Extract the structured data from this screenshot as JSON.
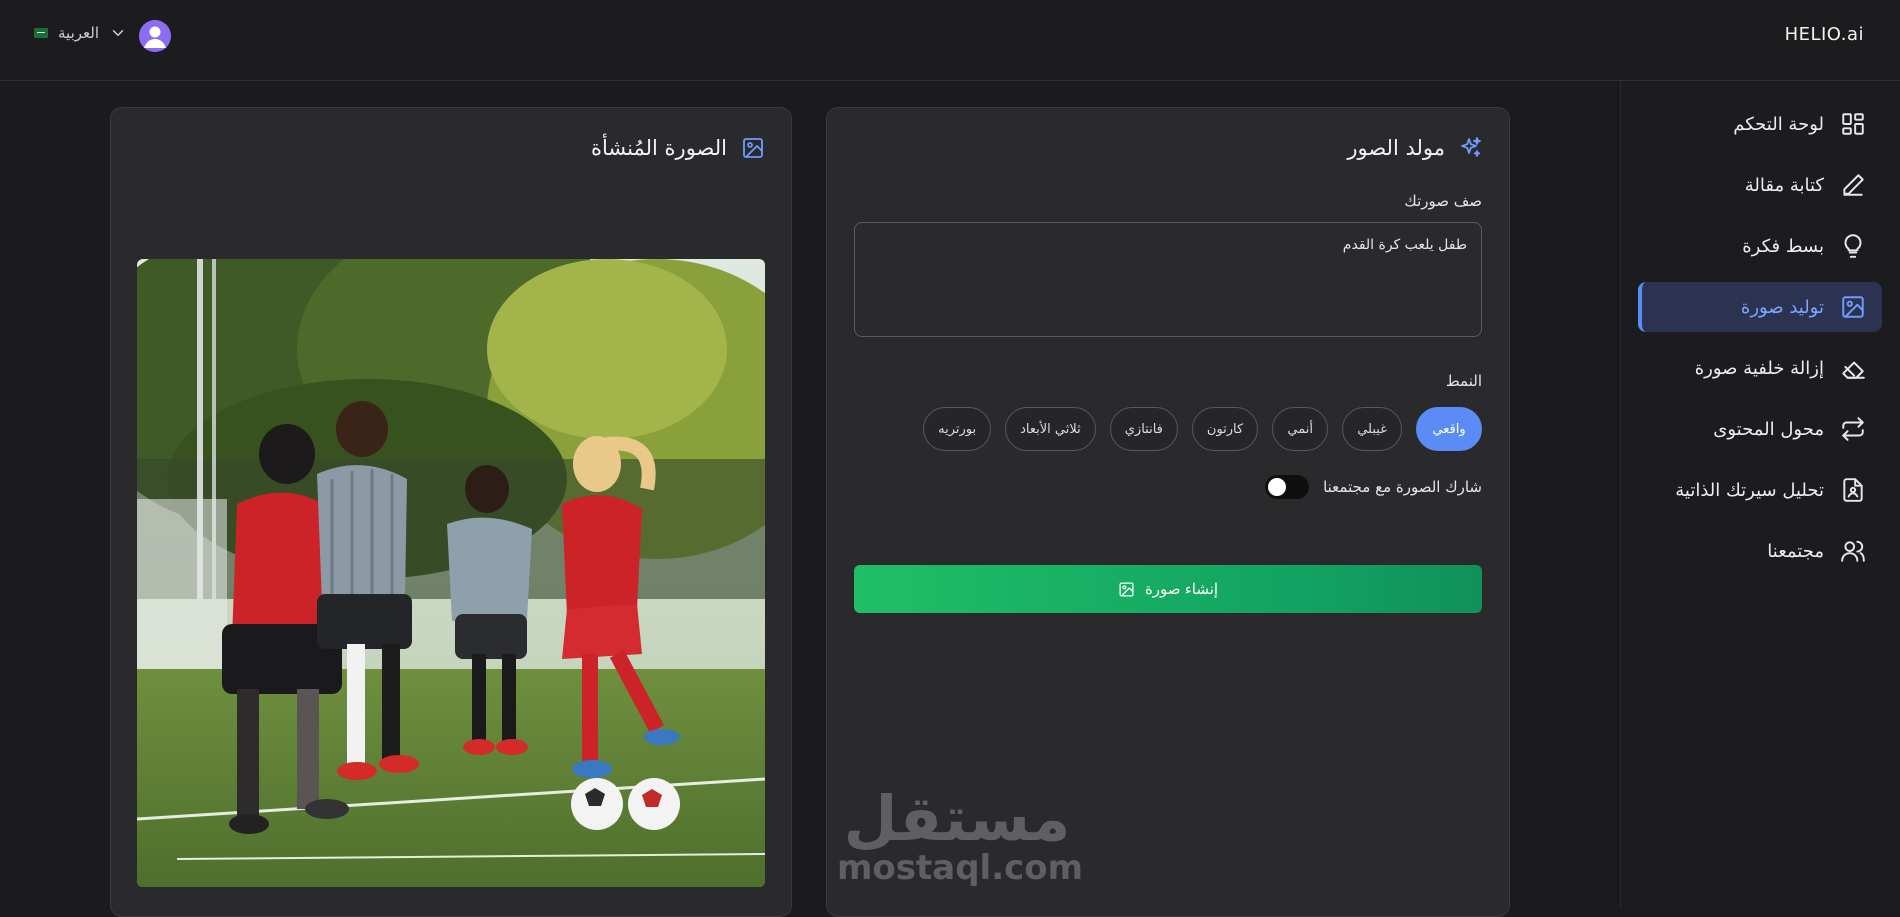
{
  "topbar": {
    "brand": "HELIO.ai",
    "language": "العربية",
    "flag_icon": "saudi-flag-icon",
    "avatar_icon": "user-avatar-icon"
  },
  "sidebar": {
    "items": [
      {
        "label": "لوحة التحكم",
        "icon": "dashboard-icon",
        "active": false
      },
      {
        "label": "كتابة مقالة",
        "icon": "pencil-icon",
        "active": false
      },
      {
        "label": "بسط فكرة",
        "icon": "lightbulb-icon",
        "active": false
      },
      {
        "label": "توليد صورة",
        "icon": "image-icon",
        "active": true
      },
      {
        "label": "إزالة خلفية صورة",
        "icon": "eraser-icon",
        "active": false
      },
      {
        "label": "محول المحتوى",
        "icon": "repeat-icon",
        "active": false
      },
      {
        "label": "تحليل سيرتك الذاتية",
        "icon": "resume-icon",
        "active": false
      },
      {
        "label": "مجتمعنا",
        "icon": "users-icon",
        "active": false
      }
    ]
  },
  "generator": {
    "title": "مولد الصور",
    "title_icon": "sparkles-icon",
    "prompt_label": "صف صورتك",
    "prompt_value": "طفل يلعب كرة القدم",
    "style_label": "النمط",
    "styles": [
      "واقعي",
      "غيبلي",
      "أنمي",
      "كارتون",
      "فانتازي",
      "ثلاثي الأبعاد",
      "بورتريه"
    ],
    "selected_style": "واقعي",
    "share_label": "شارك الصورة مع مجتمعنا",
    "share_enabled": false,
    "generate_label": "إنشاء صورة",
    "generate_icon": "image-icon"
  },
  "result": {
    "title": "الصورة المُنشأة",
    "title_icon": "image-icon",
    "image_alt": "generated-photo-children-playing-soccer"
  },
  "watermark": {
    "arabic": "مستقل",
    "latin": "mostaql.com"
  },
  "colors": {
    "accent": "#5b8cf5",
    "button_green": "#1fbf66",
    "background": "#1b1b1d",
    "card": "#2a2a2d"
  }
}
